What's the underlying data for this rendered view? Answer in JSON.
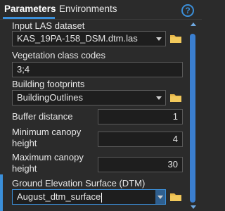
{
  "tabs": {
    "parameters": "Parameters",
    "environments": "Environments",
    "help": "?"
  },
  "fields": {
    "input_las": {
      "label": "Input LAS dataset",
      "value": "KAS_19PA-158_DSM.dtm.las"
    },
    "veg_codes": {
      "label": "Vegetation class codes",
      "value": "3;4"
    },
    "building_footprints": {
      "label": "Building footprints",
      "value": "BuildingOutlines"
    },
    "buffer_distance": {
      "label": "Buffer distance",
      "value": "1"
    },
    "min_canopy": {
      "label": "Minimum canopy height",
      "value": "4"
    },
    "max_canopy": {
      "label": "Maximum canopy height",
      "value": "30"
    },
    "ground_surface": {
      "label": "Ground Elevation Surface (DTM)",
      "value": "August_dtm_surface"
    }
  },
  "colors": {
    "accent": "#3b8fd9",
    "folder": "#e8b84a",
    "background": "#2b2b2b"
  }
}
